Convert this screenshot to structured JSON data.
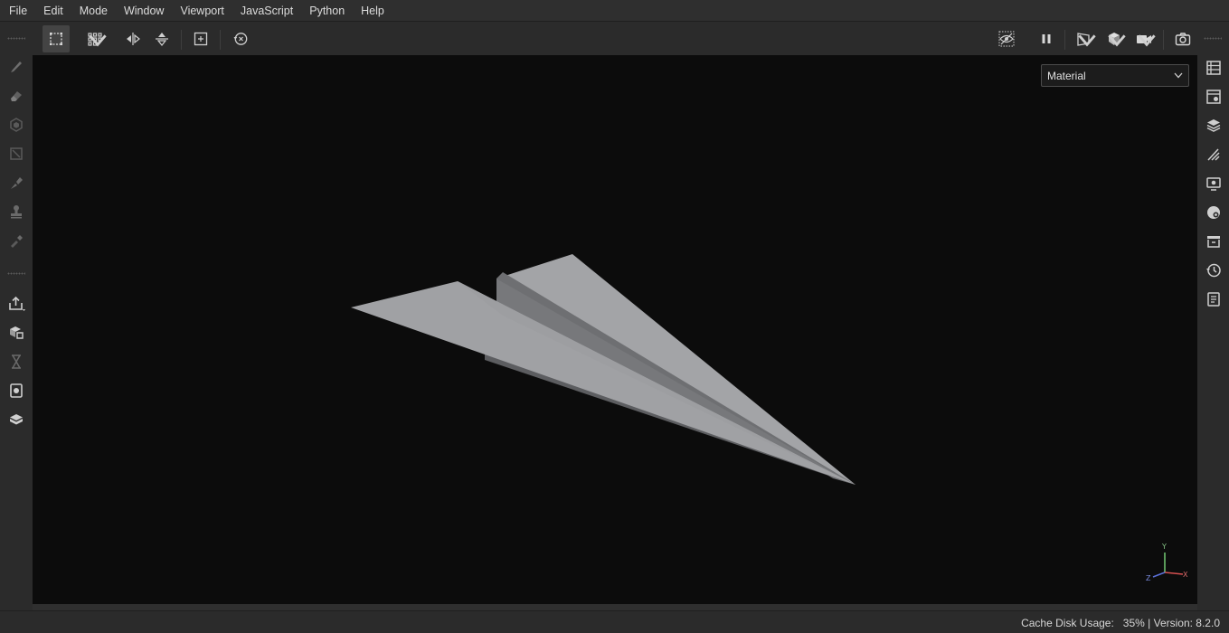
{
  "menu": {
    "items": [
      "File",
      "Edit",
      "Mode",
      "Window",
      "Viewport",
      "JavaScript",
      "Python",
      "Help"
    ]
  },
  "toolbar": {
    "left_tools": [
      "polygon-fill-icon",
      "grid-dropdown-icon",
      "mirror-x-icon",
      "mirror-y-icon",
      "fit-view-icon",
      "reset-history-icon"
    ],
    "right_tools": [
      "hide-icon",
      "pause-icon",
      "perspective-dropdown-icon",
      "display-mode-dropdown-icon",
      "camera-dropdown-icon",
      "screenshot-icon"
    ]
  },
  "left_tray": {
    "tools": [
      "paint-brush-icon",
      "eraser-icon",
      "projection-icon",
      "polygon-fill-tool-icon",
      "smudge-icon",
      "clone-stamp-icon",
      "color-picker-icon"
    ],
    "actions": [
      "export-icon",
      "bake-icon",
      "iray-render-icon",
      "screenshot-report-icon",
      "shelf-icon"
    ]
  },
  "right_tray": {
    "panels": [
      "texture-set-list-icon",
      "texture-set-settings-icon",
      "layers-icon",
      "properties-icon",
      "display-settings-icon",
      "shader-settings-icon",
      "shelf-panel-icon",
      "history-icon",
      "log-icon"
    ]
  },
  "viewport": {
    "shading_mode": "Material",
    "axis_labels": {
      "y": "Y",
      "x": "X",
      "z": "Z"
    },
    "colors": {
      "background": "#0c0c0c",
      "model": "#a0a1a4"
    }
  },
  "status": {
    "text": "Cache Disk Usage:   35% | Version: 8.2.0"
  }
}
